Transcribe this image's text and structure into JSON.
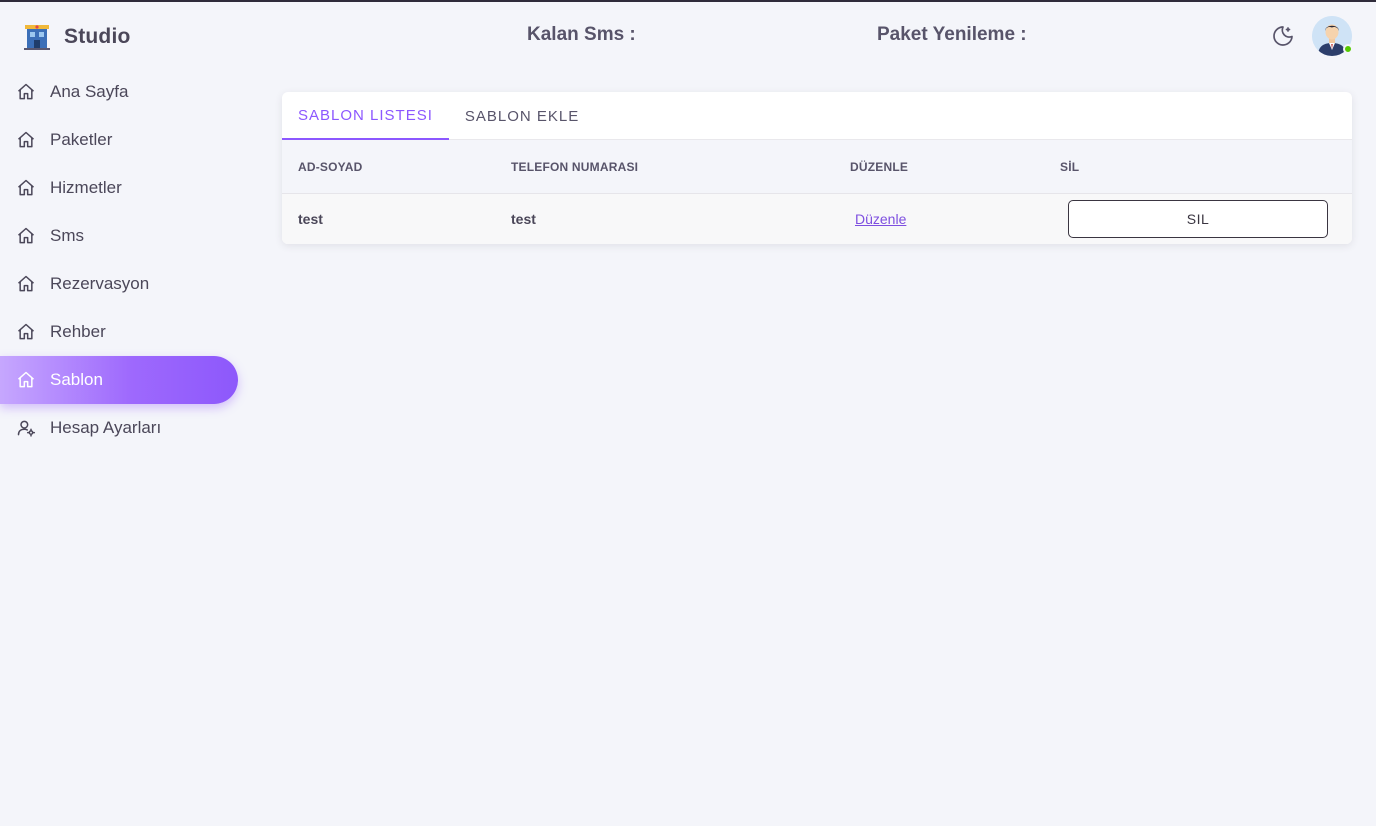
{
  "app": {
    "name": "Studio"
  },
  "header": {
    "sms_label": "Kalan Sms :",
    "renewal_label": "Paket Yenileme :"
  },
  "sidebar": {
    "items": [
      {
        "label": "Ana Sayfa",
        "icon": "home-icon"
      },
      {
        "label": "Paketler",
        "icon": "home-icon"
      },
      {
        "label": "Hizmetler",
        "icon": "home-icon"
      },
      {
        "label": "Sms",
        "icon": "home-icon"
      },
      {
        "label": "Rezervasyon",
        "icon": "home-icon"
      },
      {
        "label": "Rehber",
        "icon": "home-icon"
      },
      {
        "label": "Sablon",
        "icon": "home-icon",
        "active": true
      },
      {
        "label": "Hesap Ayarları",
        "icon": "user-settings-icon"
      }
    ]
  },
  "tabs": [
    {
      "label": "SABLON LISTESI",
      "active": true
    },
    {
      "label": "SABLON EKLE",
      "active": false
    }
  ],
  "table": {
    "headers": [
      "AD-SOYAD",
      "TELEFON NUMARASI",
      "DÜZENLE",
      "SİL"
    ],
    "rows": [
      {
        "name": "test",
        "phone": "test",
        "edit": "Düzenle",
        "delete": "SIL"
      }
    ]
  },
  "colors": {
    "accent": "#8c57ff",
    "background": "#f4f5fa",
    "online": "#56ca00"
  }
}
